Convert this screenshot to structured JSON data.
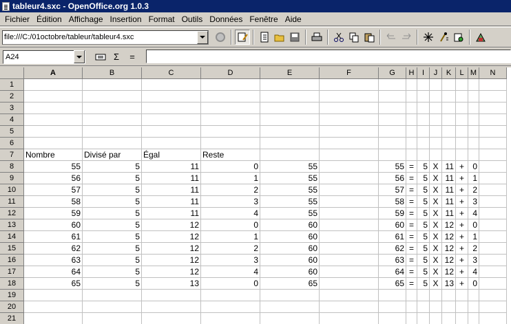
{
  "window": {
    "title": "tableur4.sxc - OpenOffice.org 1.0.3"
  },
  "menu": [
    "Fichier",
    "Édition",
    "Affichage",
    "Insertion",
    "Format",
    "Outils",
    "Données",
    "Fenêtre",
    "Aide"
  ],
  "toolbar": {
    "url": "file:///C:/01octobre/tableur/tableur4.sxc"
  },
  "formula_bar": {
    "cell_ref": "A24",
    "sum_label": "Σ",
    "equals_label": "=",
    "content": ""
  },
  "grid": {
    "columns": [
      "A",
      "B",
      "C",
      "D",
      "E",
      "F",
      "G",
      "H",
      "I",
      "J",
      "K",
      "L",
      "M",
      "N"
    ],
    "rows": [
      "1",
      "2",
      "3",
      "4",
      "5",
      "6",
      "7",
      "8",
      "9",
      "10",
      "11",
      "12",
      "13",
      "14",
      "15",
      "16",
      "17",
      "18",
      "19",
      "20",
      "21"
    ],
    "headers_row7": [
      "Nombre",
      "Divisé par",
      "Égal",
      "Reste"
    ],
    "data": [
      [
        "55",
        "5",
        "11",
        "0",
        "55",
        "",
        "55",
        "=",
        "5",
        "X",
        "11",
        "+",
        "0"
      ],
      [
        "56",
        "5",
        "11",
        "1",
        "55",
        "",
        "56",
        "=",
        "5",
        "X",
        "11",
        "+",
        "1"
      ],
      [
        "57",
        "5",
        "11",
        "2",
        "55",
        "",
        "57",
        "=",
        "5",
        "X",
        "11",
        "+",
        "2"
      ],
      [
        "58",
        "5",
        "11",
        "3",
        "55",
        "",
        "58",
        "=",
        "5",
        "X",
        "11",
        "+",
        "3"
      ],
      [
        "59",
        "5",
        "11",
        "4",
        "55",
        "",
        "59",
        "=",
        "5",
        "X",
        "11",
        "+",
        "4"
      ],
      [
        "60",
        "5",
        "12",
        "0",
        "60",
        "",
        "60",
        "=",
        "5",
        "X",
        "12",
        "+",
        "0"
      ],
      [
        "61",
        "5",
        "12",
        "1",
        "60",
        "",
        "61",
        "=",
        "5",
        "X",
        "12",
        "+",
        "1"
      ],
      [
        "62",
        "5",
        "12",
        "2",
        "60",
        "",
        "62",
        "=",
        "5",
        "X",
        "12",
        "+",
        "2"
      ],
      [
        "63",
        "5",
        "12",
        "3",
        "60",
        "",
        "63",
        "=",
        "5",
        "X",
        "12",
        "+",
        "3"
      ],
      [
        "64",
        "5",
        "12",
        "4",
        "60",
        "",
        "64",
        "=",
        "5",
        "X",
        "12",
        "+",
        "4"
      ],
      [
        "65",
        "5",
        "13",
        "0",
        "65",
        "",
        "65",
        "=",
        "5",
        "X",
        "13",
        "+",
        "0"
      ]
    ]
  }
}
